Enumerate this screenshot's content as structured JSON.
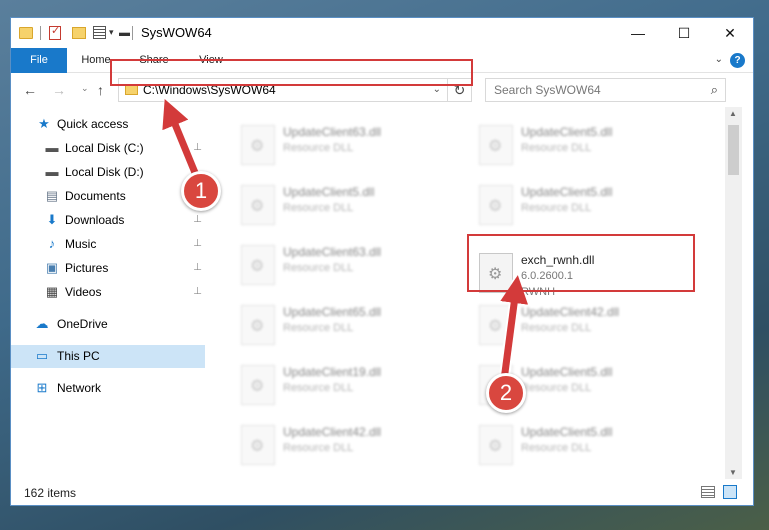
{
  "window": {
    "title": "SysWOW64",
    "controls": {
      "minimize": "—",
      "maximize": "☐",
      "close": "✕"
    }
  },
  "ribbon": {
    "tabs": [
      "File",
      "Home",
      "Share",
      "View"
    ],
    "expand_icon": "chevron-down-icon",
    "help": "?"
  },
  "navigation": {
    "back": "←",
    "forward": "→",
    "recent": "⌄",
    "up": "↑",
    "address": "C:\\Windows\\SysWOW64",
    "refresh": "↻",
    "search_placeholder": "Search SysWOW64"
  },
  "sidebar": {
    "items": [
      {
        "label": "Quick access",
        "icon": "star-icon",
        "glyph": "★",
        "color": "#1979ca",
        "pinned": false
      },
      {
        "label": "Local Disk (C:)",
        "icon": "drive-icon",
        "glyph": "▬",
        "color": "#555555",
        "pinned": true
      },
      {
        "label": "Local Disk (D:)",
        "icon": "drive-icon",
        "glyph": "▬",
        "color": "#555555",
        "pinned": true
      },
      {
        "label": "Documents",
        "icon": "documents-icon",
        "glyph": "▤",
        "color": "#6b7a8c",
        "pinned": true
      },
      {
        "label": "Downloads",
        "icon": "download-icon",
        "glyph": "⬇",
        "color": "#1979ca",
        "pinned": true
      },
      {
        "label": "Music",
        "icon": "music-icon",
        "glyph": "♪",
        "color": "#1979ca",
        "pinned": true
      },
      {
        "label": "Pictures",
        "icon": "pictures-icon",
        "glyph": "▣",
        "color": "#4a7fb0",
        "pinned": true
      },
      {
        "label": "Videos",
        "icon": "videos-icon",
        "glyph": "▦",
        "color": "#444444",
        "pinned": true
      },
      {
        "label": "OneDrive",
        "icon": "cloud-icon",
        "glyph": "☁",
        "color": "#1979ca",
        "pinned": false
      },
      {
        "label": "This PC",
        "icon": "computer-icon",
        "glyph": "▭",
        "color": "#1979ca",
        "pinned": false
      },
      {
        "label": "Network",
        "icon": "network-icon",
        "glyph": "⊞",
        "color": "#1979ca",
        "pinned": false
      }
    ],
    "pin_glyph": "📌"
  },
  "files": [
    {
      "name": "UpdateClient63.dll",
      "desc": "Resource DLL"
    },
    {
      "name": "UpdateClient5.dll",
      "desc": "Resource DLL"
    },
    {
      "name": "UpdateClient5.dll",
      "desc": "Resource DLL"
    },
    {
      "name": "UpdateClient5.dll",
      "desc": "Resource DLL"
    },
    {
      "name": "UpdateClient63.dll",
      "desc": "Resource DLL"
    },
    {
      "name": "exch_rwnh.dll",
      "desc": "6.0.2600.1",
      "extra": "RWNH"
    },
    {
      "name": "UpdateClient65.dll",
      "desc": "Resource DLL"
    },
    {
      "name": "UpdateClient42.dll",
      "desc": "Resource DLL"
    },
    {
      "name": "UpdateClient19.dll",
      "desc": "Resource DLL"
    },
    {
      "name": "UpdateClient5.dll",
      "desc": "Resource DLL"
    },
    {
      "name": "UpdateClient42.dll",
      "desc": "Resource DLL"
    },
    {
      "name": "UpdateClient5.dll",
      "desc": "Resource DLL"
    }
  ],
  "status": {
    "item_count": "162 items"
  },
  "annotations": {
    "step1": "1",
    "step2": "2",
    "color": "#d33a3a"
  }
}
